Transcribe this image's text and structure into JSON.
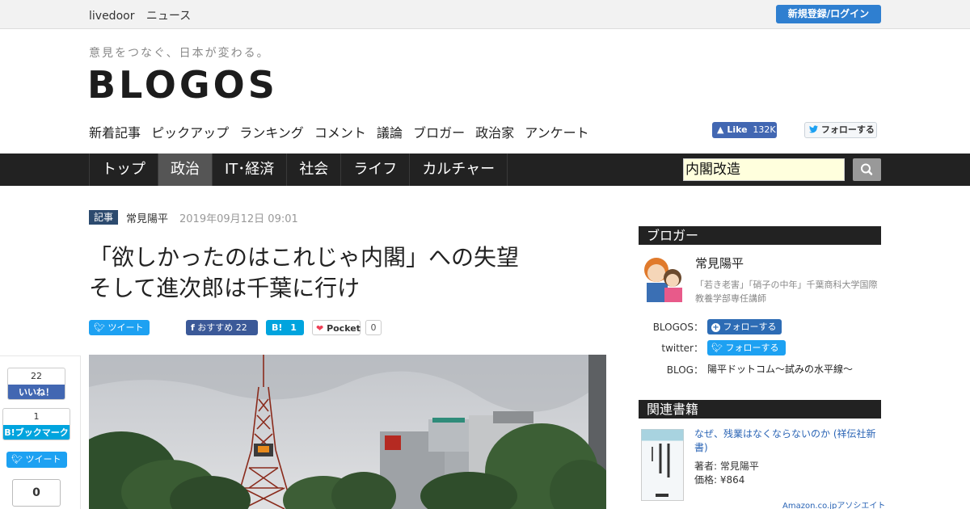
{
  "topbar": {
    "brand": "livedoor",
    "brand_sub": "ニュース",
    "login": "新規登録/ログイン"
  },
  "header": {
    "tagline": "意見をつなぐ、日本が変わる。",
    "logo": "BLOGOS",
    "subnav": [
      "新着記事",
      "ピックアップ",
      "ランキング",
      "コメント",
      "議論",
      "ブロガー",
      "政治家",
      "アンケート"
    ],
    "fb_like": {
      "label": "Like",
      "count": "132K"
    },
    "twitter_follow": "フォローする"
  },
  "mainnav": {
    "tabs": [
      "トップ",
      "政治",
      "IT･経済",
      "社会",
      "ライフ",
      "カルチャー"
    ],
    "active_index": 1,
    "search_value": "内閣改造"
  },
  "article": {
    "category": "記事",
    "author": "常見陽平",
    "date": "2019年09月12日 09:01",
    "title_line1": "「欲しかったのはこれじゃ内閣」への失望",
    "title_line2": "そして進次郎は千葉に行け",
    "share": {
      "tweet": "ツイート",
      "fb_label": "おすすめ",
      "fb_count": "22",
      "hatena_label": "B!",
      "hatena_count": "1",
      "pocket_label": "Pocket",
      "pocket_count": "0"
    }
  },
  "float_share": {
    "like_count": "22",
    "like_label": "いいね！",
    "hatena_count": "1",
    "hatena_label": "B!ブックマーク",
    "tweet": "ツイート",
    "pocket_count": "0"
  },
  "sidebar": {
    "blogger_heading": "ブロガー",
    "blogger_name": "常見陽平",
    "blogger_desc": "「若き老害」「硝子の中年」千葉商科大学国際教養学部専任講師",
    "blogos_label": "BLOGOS：",
    "blogos_btn": "フォローする",
    "twitter_label": "twitter：",
    "twitter_btn": "フォローする",
    "blog_label": "BLOG：",
    "blog_value": "陽平ドットコム～試みの水平線～",
    "books_heading": "関連書籍",
    "book_title": "なぜ、残業はなくならないのか (祥伝社新書)",
    "book_author": "著者: 常見陽平",
    "book_price": "価格: ¥864",
    "amazon": "Amazon.co.jpアソシエイト"
  },
  "colors": {
    "accent_blue": "#2f7fd0",
    "nav_bg": "#222222",
    "facebook": "#4267b2",
    "twitter": "#1da1f2",
    "hatena": "#00a4de"
  }
}
